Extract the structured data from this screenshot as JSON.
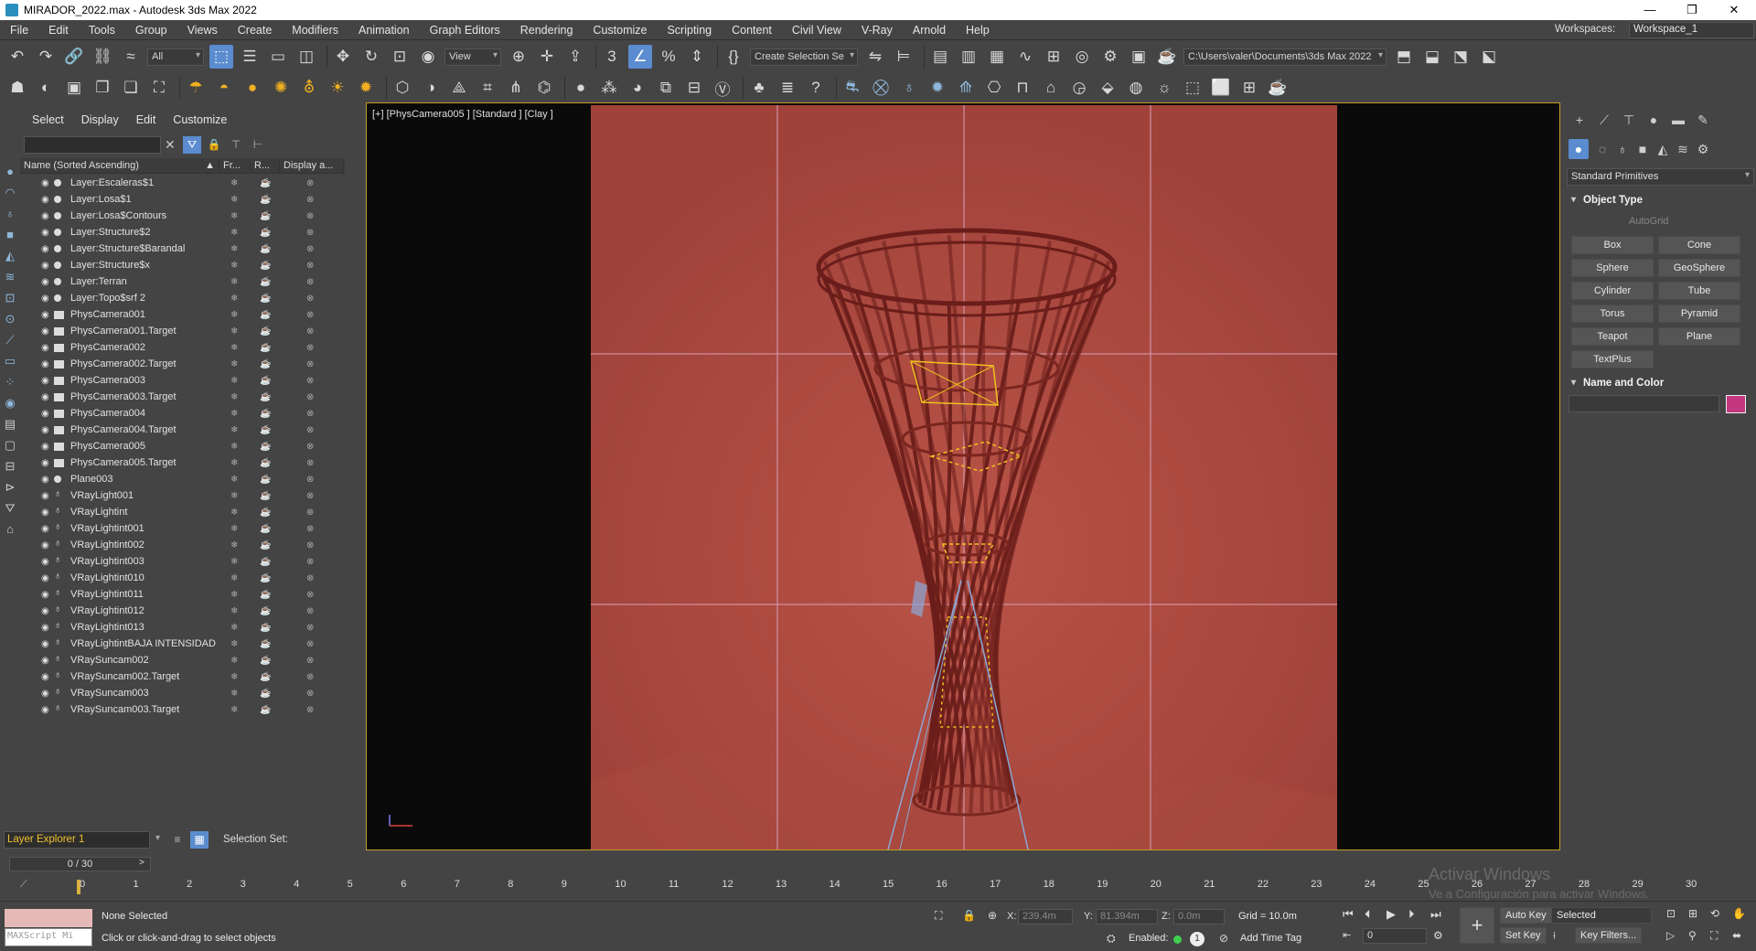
{
  "window": {
    "title": "MIRADOR_2022.max - Autodesk 3ds Max 2022",
    "controls": {
      "minimize": "—",
      "restore": "❐",
      "close": "✕"
    }
  },
  "menu": [
    "File",
    "Edit",
    "Tools",
    "Group",
    "Views",
    "Create",
    "Modifiers",
    "Animation",
    "Graph Editors",
    "Rendering",
    "Customize",
    "Scripting",
    "Content",
    "Civil View",
    "V-Ray",
    "Arnold",
    "Help"
  ],
  "workspace": {
    "label": "Workspaces:",
    "value": "Workspace_1"
  },
  "toolbar": {
    "filter_value": "All",
    "refcoord_value": "View",
    "selection_set": "Create Selection Se",
    "path": "C:\\Users\\valer\\Documents\\3ds Max 2022"
  },
  "explorer": {
    "menu": [
      "Select",
      "Display",
      "Edit",
      "Customize"
    ],
    "columns": [
      "Name (Sorted Ascending)",
      "Fr...",
      "R...",
      "Display a..."
    ],
    "rows": [
      {
        "name": "Layer:Escaleras$1",
        "icon": "layer"
      },
      {
        "name": "Layer:Losa$1",
        "icon": "layer"
      },
      {
        "name": "Layer:Losa$Contours",
        "icon": "layer"
      },
      {
        "name": "Layer:Structure$2",
        "icon": "layer"
      },
      {
        "name": "Layer:Structure$Barandal",
        "icon": "layer"
      },
      {
        "name": "Layer:Structure$x",
        "icon": "layer"
      },
      {
        "name": "Layer:Terran",
        "icon": "layer"
      },
      {
        "name": "Layer:Topo$srf 2",
        "icon": "layer"
      },
      {
        "name": "PhysCamera001",
        "icon": "camera"
      },
      {
        "name": "PhysCamera001.Target",
        "icon": "camera"
      },
      {
        "name": "PhysCamera002",
        "icon": "camera"
      },
      {
        "name": "PhysCamera002.Target",
        "icon": "camera"
      },
      {
        "name": "PhysCamera003",
        "icon": "camera"
      },
      {
        "name": "PhysCamera003.Target",
        "icon": "camera"
      },
      {
        "name": "PhysCamera004",
        "icon": "camera"
      },
      {
        "name": "PhysCamera004.Target",
        "icon": "camera"
      },
      {
        "name": "PhysCamera005",
        "icon": "camera"
      },
      {
        "name": "PhysCamera005.Target",
        "icon": "camera"
      },
      {
        "name": "Plane003",
        "icon": "layer"
      },
      {
        "name": "VRayLight001",
        "icon": "light"
      },
      {
        "name": "VRayLightint",
        "icon": "light"
      },
      {
        "name": "VRayLightint001",
        "icon": "light"
      },
      {
        "name": "VRayLightint002",
        "icon": "light"
      },
      {
        "name": "VRayLightint003",
        "icon": "light"
      },
      {
        "name": "VRayLightint010",
        "icon": "light"
      },
      {
        "name": "VRayLightint011",
        "icon": "light"
      },
      {
        "name": "VRayLightint012",
        "icon": "light"
      },
      {
        "name": "VRayLightint013",
        "icon": "light"
      },
      {
        "name": "VRayLightintBAJA INTENSIDAD",
        "icon": "light"
      },
      {
        "name": "VRaySuncam002",
        "icon": "light"
      },
      {
        "name": "VRaySuncam002.Target",
        "icon": "light"
      },
      {
        "name": "VRaySuncam003",
        "icon": "light"
      },
      {
        "name": "VRaySuncam003.Target",
        "icon": "light"
      }
    ],
    "layer_explorer": "Layer Explorer 1",
    "selection_set_label": "Selection Set:"
  },
  "viewport": {
    "label": "[+] [PhysCamera005 ] [Standard ] [Clay ]",
    "bg_color": "#ad4a40"
  },
  "command_panel": {
    "category": "Standard Primitives",
    "object_type_title": "Object Type",
    "autogrid": "AutoGrid",
    "primitives": [
      "Box",
      "Cone",
      "Sphere",
      "GeoSphere",
      "Cylinder",
      "Tube",
      "Torus",
      "Pyramid",
      "Teapot",
      "Plane",
      "TextPlus"
    ],
    "name_color_title": "Name and Color",
    "object_color": "#c4367e"
  },
  "timeline": {
    "frame_display": "0 / 30",
    "ticks": [
      "0",
      "1",
      "2",
      "3",
      "4",
      "5",
      "6",
      "7",
      "8",
      "9",
      "10",
      "11",
      "12",
      "13",
      "14",
      "15",
      "16",
      "17",
      "18",
      "19",
      "20",
      "21",
      "22",
      "23",
      "24",
      "25",
      "26",
      "27",
      "28",
      "29",
      "30"
    ]
  },
  "status": {
    "maxscript_placeholder": "MAXScript Mi",
    "selection": "None Selected",
    "hint": "Click or click-and-drag to select objects",
    "x_label": "X:",
    "x_value": "239.4m",
    "y_label": "Y:",
    "y_value": "81.394m",
    "z_label": "Z:",
    "z_value": "0.0m",
    "grid": "Grid = 10.0m",
    "enabled": "Enabled:",
    "add_time_tag": "Add Time Tag",
    "auto_key": "Auto Key",
    "set_key": "Set Key",
    "selected": "Selected",
    "key_filters": "Key Filters...",
    "frame_value": "0"
  },
  "watermark": {
    "line1": "Activar Windows",
    "line2": "Ve a Configuración para activar Windows."
  }
}
